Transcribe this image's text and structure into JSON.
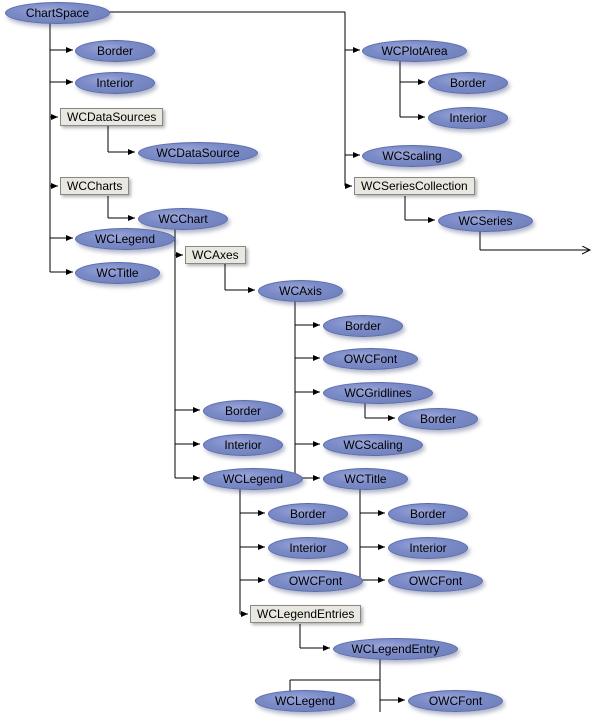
{
  "nodes": {
    "chartspace": "ChartSpace",
    "border1": "Border",
    "interior1": "Interior",
    "wcdatasources": "WCDataSources",
    "wcdatasource": "WCDataSource",
    "wccharts": "WCCharts",
    "wcchart": "WCChart",
    "wclegend1": "WCLegend",
    "wctitle1": "WCTitle",
    "wcaxes": "WCAxes",
    "wcplotarea": "WCPlotArea",
    "border_pa": "Border",
    "interior_pa": "Interior",
    "wcscaling_pa": "WCScaling",
    "wcseriescoll": "WCSeriesCollection",
    "wcseries": "WCSeries",
    "wcaxis": "WCAxis",
    "border_ax": "Border",
    "owcfont_ax": "OWCFont",
    "wcgridlines": "WCGridlines",
    "border_gl": "Border",
    "wcscaling_ax": "WCScaling",
    "wctitle_ax": "WCTitle",
    "border_ch": "Border",
    "interior_ch": "Interior",
    "wclegend_ch": "WCLegend",
    "border_lg": "Border",
    "interior_lg": "Interior",
    "owcfont_lg": "OWCFont",
    "wclegendentries": "WCLegendEntries",
    "wclegendentry": "WCLegendEntry",
    "wclegend_le": "WCLegend",
    "owcfont_le": "OWCFont",
    "border_ti": "Border",
    "interior_ti": "Interior",
    "owcfont_ti": "OWCFont"
  }
}
